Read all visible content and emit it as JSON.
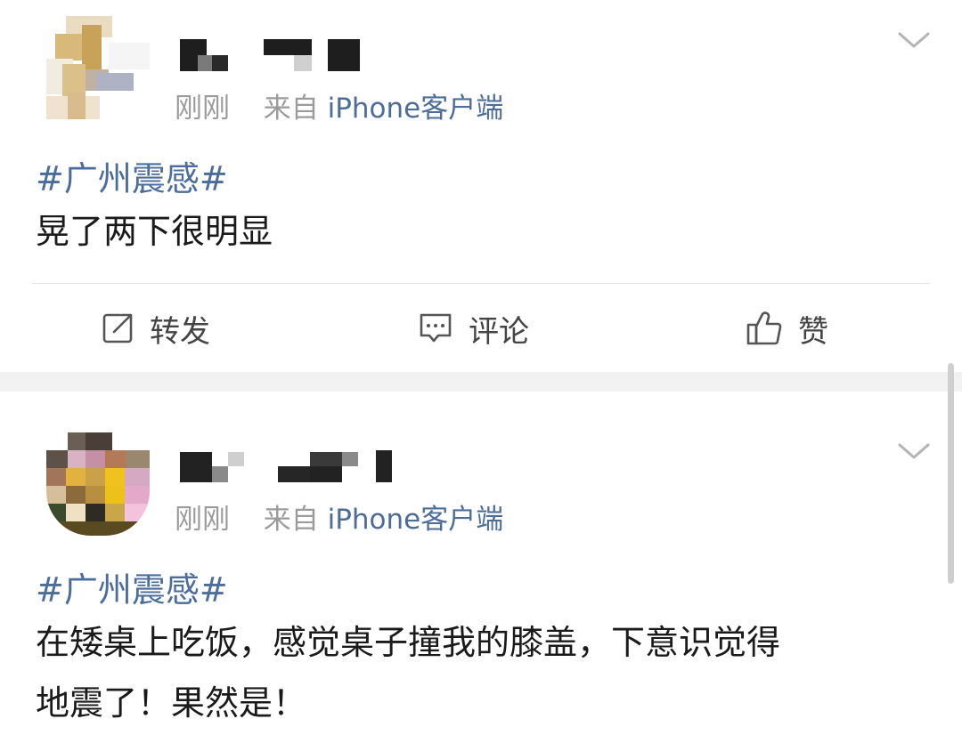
{
  "posts": [
    {
      "time": "刚刚",
      "source_prefix": "来自",
      "source": "iPhone客户端",
      "topic": "#广州震感#",
      "text": "晃了两下很明显",
      "actions": {
        "repost": "转发",
        "comment": "评论",
        "like": "赞"
      }
    },
    {
      "time": "刚刚",
      "source_prefix": "来自",
      "source": "iPhone客户端",
      "topic": "#广州震感#",
      "text_line1": "在矮桌上吃饭，感觉桌子撞我的膝盖，下意识觉得",
      "text_line2": "地震了！果然是！"
    }
  ],
  "icons": {
    "more": "chevron-down-icon",
    "repost": "edit-square-icon",
    "comment": "comment-bubble-icon",
    "like": "thumbs-up-icon"
  },
  "colors": {
    "link": "#4b6d9c",
    "meta": "#9b9b9b",
    "separator": "#f2f2f2",
    "text": "#1a1a1a"
  }
}
